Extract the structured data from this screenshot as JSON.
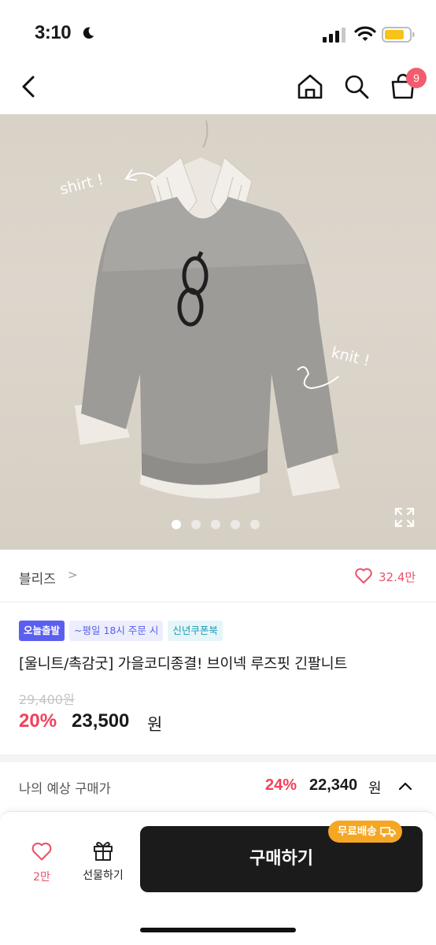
{
  "status_bar": {
    "time": "3:10"
  },
  "nav": {
    "cart_count": "9"
  },
  "hero": {
    "active_slide": 1,
    "slide_count": 5,
    "annotations": {
      "shirt": "shirt !",
      "knit": "knit !"
    }
  },
  "store": {
    "name": "블리즈",
    "chevron": ">",
    "likes": "32.4만"
  },
  "tags": [
    "오늘출발",
    "~평일 18시 주문 시",
    "신년쿠폰북"
  ],
  "product": {
    "title": "[울니트/촉감굿] 가을코디종결! 브이넥 루즈핏 긴팔니트",
    "original_price": "29,400원",
    "discount": "20%",
    "price": "23,500",
    "price_unit": "원"
  },
  "expected": {
    "label": "나의 예상 구매가",
    "discount": "24%",
    "price": "22,340",
    "unit": "원"
  },
  "bottom": {
    "like_label": "2만",
    "gift_label": "선물하기",
    "buy_label": "구매하기",
    "free_shipping": "무료배송"
  },
  "colors": {
    "accent_red": "#f2405b",
    "tag_blue": "#5b5fef",
    "coupon_teal": "#1e9bb5",
    "badge_orange": "#f5a623"
  }
}
